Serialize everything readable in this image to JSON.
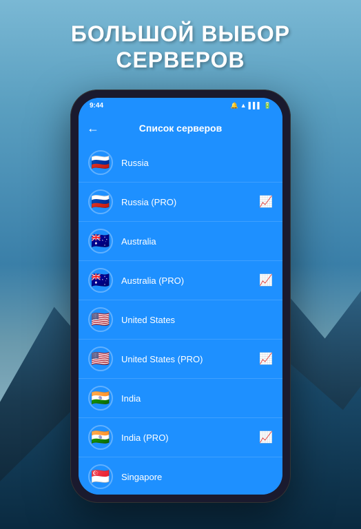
{
  "background": {
    "color_top": "#7ab8d4",
    "color_bottom": "#4a8090"
  },
  "title": {
    "line1": "БОЛЬШОЙ ВЫБОР",
    "line2": "СЕРВЕРОВ"
  },
  "phone": {
    "status_bar": {
      "time": "9:44",
      "icons": [
        "📶",
        "🔋"
      ]
    },
    "toolbar": {
      "back_label": "←",
      "title": "Список серверов"
    },
    "servers": [
      {
        "id": 1,
        "name": "Russia",
        "flag": "🇷🇺",
        "pro": false
      },
      {
        "id": 2,
        "name": "Russia (PRO)",
        "flag": "🇷🇺",
        "pro": true
      },
      {
        "id": 3,
        "name": "Australia",
        "flag": "🇦🇺",
        "pro": false
      },
      {
        "id": 4,
        "name": "Australia (PRO)",
        "flag": "🇦🇺",
        "pro": true
      },
      {
        "id": 5,
        "name": "United States",
        "flag": "🇺🇸",
        "pro": false
      },
      {
        "id": 6,
        "name": "United States (PRO)",
        "flag": "🇺🇸",
        "pro": true
      },
      {
        "id": 7,
        "name": "India",
        "flag": "🇮🇳",
        "pro": false
      },
      {
        "id": 8,
        "name": "India (PRO)",
        "flag": "🇮🇳",
        "pro": true
      },
      {
        "id": 9,
        "name": "Singapore",
        "flag": "🇸🇬",
        "pro": false
      }
    ],
    "pro_icon": "📈",
    "pro_icon_symbol": "↗"
  }
}
